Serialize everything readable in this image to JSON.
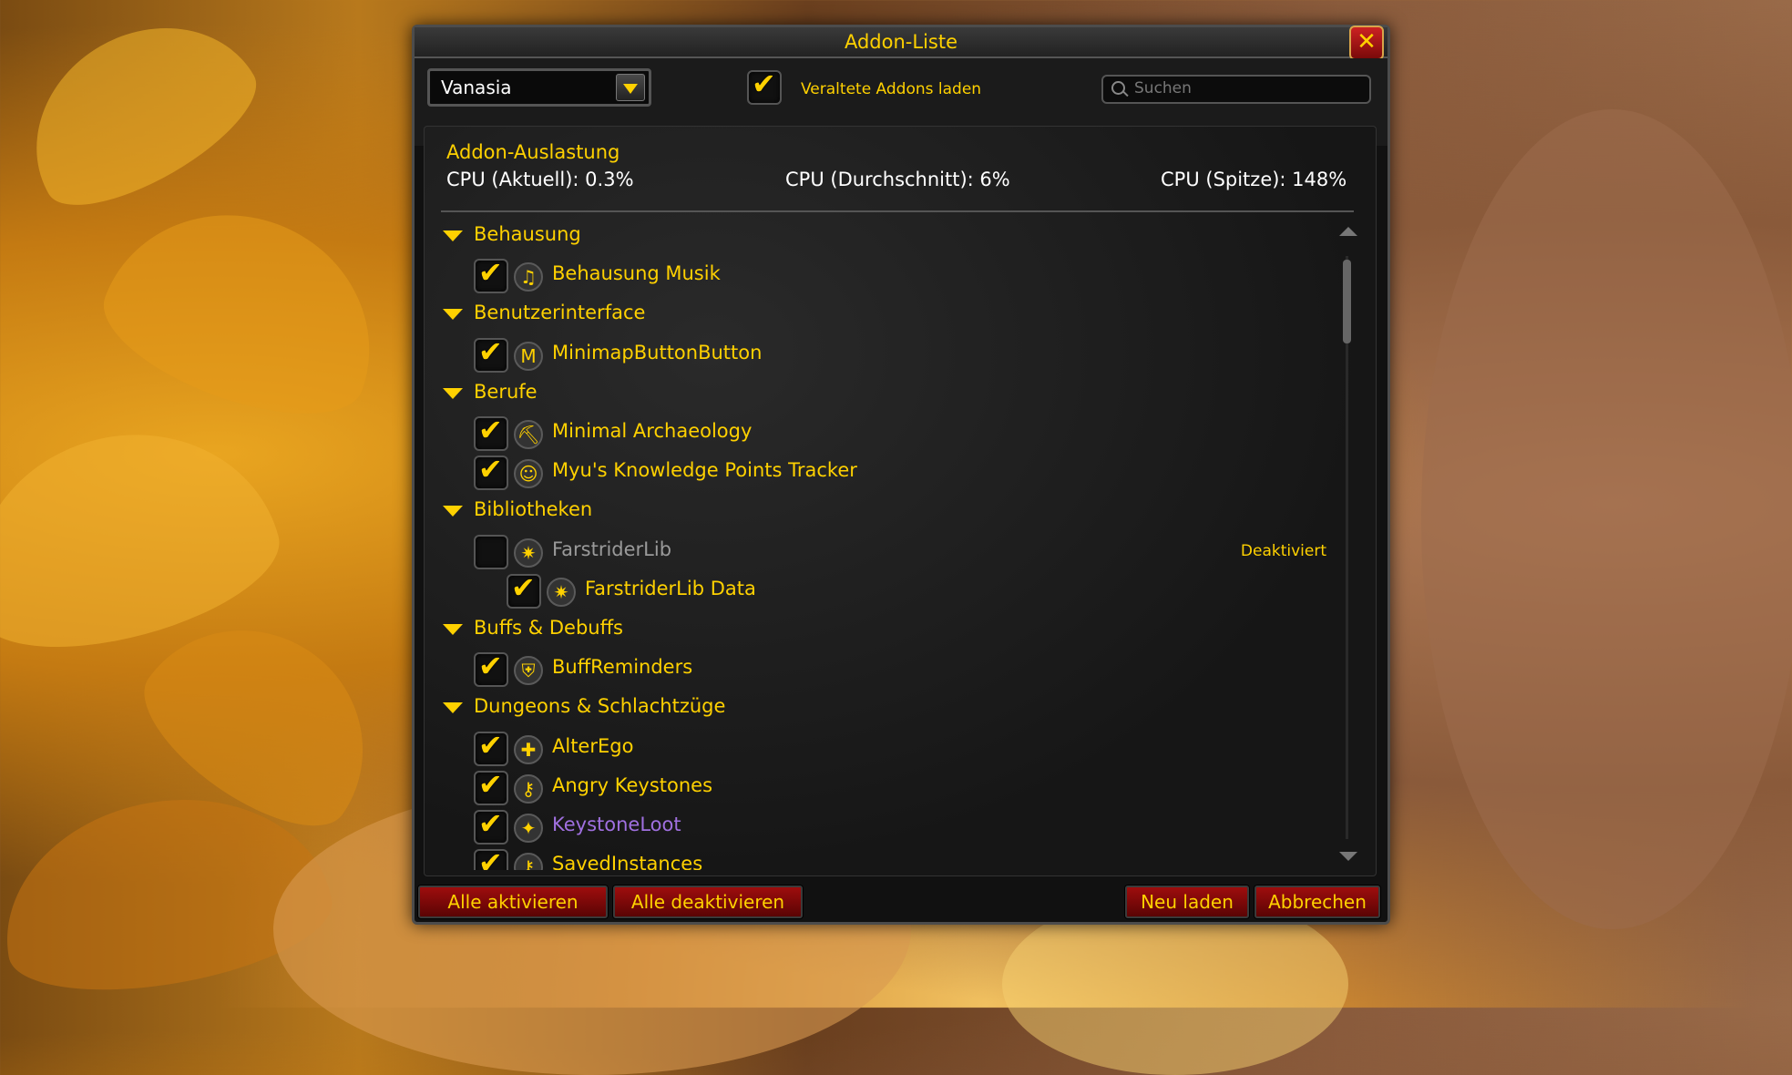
{
  "window": {
    "title": "Addon-Liste",
    "close_symbol": "✕"
  },
  "toolbar": {
    "character_dropdown": {
      "value": "Vanasia"
    },
    "outdated_checkbox": {
      "checked": true,
      "label": "Veraltete Addons laden"
    },
    "search": {
      "placeholder": "Suchen"
    }
  },
  "cpu": {
    "title": "Addon-Auslastung",
    "current": "CPU (Aktuell): 0.3%",
    "average": "CPU (Durchschnitt): 6%",
    "peak": "CPU (Spitze): 148%"
  },
  "addon_list": [
    {
      "type": "category",
      "label": "Behausung"
    },
    {
      "type": "addon",
      "label": "Behausung Musik",
      "checked": true,
      "icon": "music-note-icon",
      "glyph": "♫",
      "color": "#ffd100"
    },
    {
      "type": "category",
      "label": "Benutzerinterface"
    },
    {
      "type": "addon",
      "label": "MinimapButtonButton",
      "checked": true,
      "icon": "m-logo-icon",
      "glyph": "M",
      "color": "#ffd100"
    },
    {
      "type": "category",
      "label": "Berufe"
    },
    {
      "type": "addon",
      "label": "Minimal Archaeology",
      "checked": true,
      "icon": "trowel-icon",
      "glyph": "⛏",
      "color": "#ffd100"
    },
    {
      "type": "addon",
      "label": "Myu's Knowledge Points Tracker",
      "checked": true,
      "icon": "goblin-icon",
      "glyph": "☺",
      "color": "#ffd100"
    },
    {
      "type": "category",
      "label": "Bibliotheken"
    },
    {
      "type": "addon",
      "label": "FarstriderLib",
      "checked": false,
      "icon": "farstrider-emblem-icon",
      "glyph": "✷",
      "color": "#9a9a9a",
      "status": "Deaktiviert"
    },
    {
      "type": "addon",
      "label": "FarstriderLib Data",
      "checked": true,
      "icon": "farstrider-emblem-icon",
      "glyph": "✷",
      "color": "#ffd100",
      "indent": 1
    },
    {
      "type": "category",
      "label": "Buffs & Debuffs"
    },
    {
      "type": "addon",
      "label": "BuffReminders",
      "checked": true,
      "icon": "shield-buff-icon",
      "glyph": "⛨",
      "color": "#ffd100"
    },
    {
      "type": "category",
      "label": "Dungeons & Schlachtzüge"
    },
    {
      "type": "addon",
      "label": "AlterEgo",
      "checked": true,
      "icon": "plus-icon",
      "glyph": "✚",
      "color": "#ffd100"
    },
    {
      "type": "addon",
      "label": "Angry Keystones",
      "checked": true,
      "icon": "key-icon",
      "glyph": "⚷",
      "color": "#ffd100"
    },
    {
      "type": "addon",
      "label": "KeystoneLoot",
      "checked": true,
      "icon": "loot-icon",
      "glyph": "✦",
      "color": "#a070e0"
    },
    {
      "type": "addon",
      "label": "SavedInstances",
      "checked": true,
      "icon": "key-icon",
      "glyph": "⚷",
      "color": "#ffd100"
    }
  ],
  "buttons": {
    "enable_all": "Alle aktivieren",
    "disable_all": "Alle deaktivieren",
    "reload": "Neu laden",
    "cancel": "Abbrechen"
  }
}
